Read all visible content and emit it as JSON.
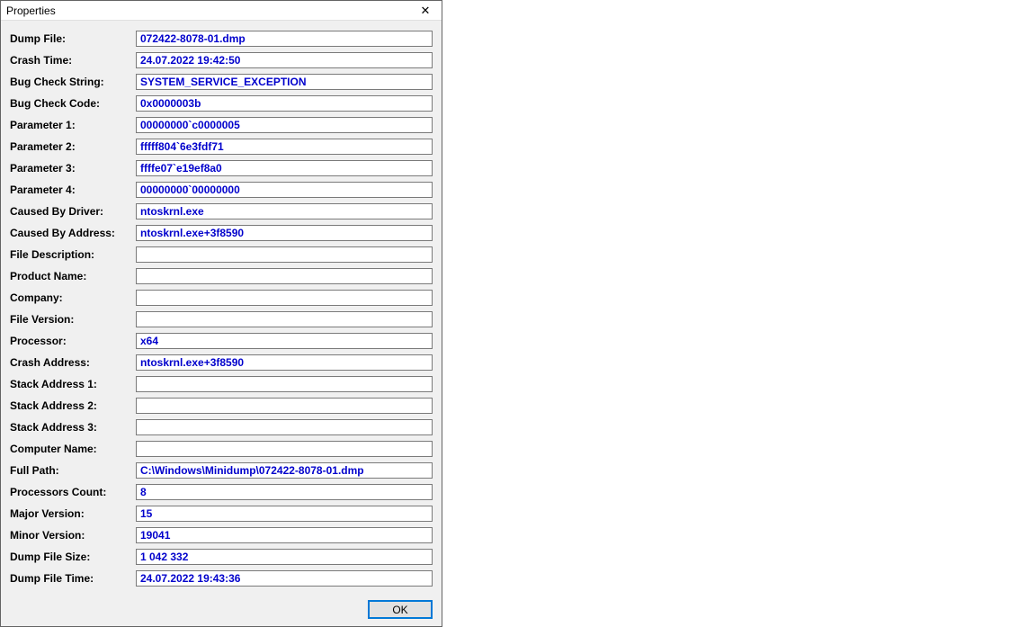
{
  "window": {
    "title": "Properties",
    "close_icon": "✕"
  },
  "fields": [
    {
      "label": "Dump File:",
      "value": "072422-8078-01.dmp"
    },
    {
      "label": "Crash Time:",
      "value": "24.07.2022 19:42:50"
    },
    {
      "label": "Bug Check String:",
      "value": "SYSTEM_SERVICE_EXCEPTION"
    },
    {
      "label": "Bug Check Code:",
      "value": "0x0000003b"
    },
    {
      "label": "Parameter 1:",
      "value": "00000000`c0000005"
    },
    {
      "label": "Parameter 2:",
      "value": "fffff804`6e3fdf71"
    },
    {
      "label": "Parameter 3:",
      "value": "ffffe07`e19ef8a0"
    },
    {
      "label": "Parameter 4:",
      "value": "00000000`00000000"
    },
    {
      "label": "Caused By Driver:",
      "value": "ntoskrnl.exe"
    },
    {
      "label": "Caused By Address:",
      "value": "ntoskrnl.exe+3f8590"
    },
    {
      "label": "File Description:",
      "value": ""
    },
    {
      "label": "Product Name:",
      "value": ""
    },
    {
      "label": "Company:",
      "value": ""
    },
    {
      "label": "File Version:",
      "value": ""
    },
    {
      "label": "Processor:",
      "value": "x64"
    },
    {
      "label": "Crash Address:",
      "value": "ntoskrnl.exe+3f8590"
    },
    {
      "label": "Stack Address 1:",
      "value": ""
    },
    {
      "label": "Stack Address 2:",
      "value": ""
    },
    {
      "label": "Stack Address 3:",
      "value": ""
    },
    {
      "label": "Computer Name:",
      "value": ""
    },
    {
      "label": "Full Path:",
      "value": "C:\\Windows\\Minidump\\072422-8078-01.dmp"
    },
    {
      "label": "Processors Count:",
      "value": "8"
    },
    {
      "label": "Major Version:",
      "value": "15"
    },
    {
      "label": "Minor Version:",
      "value": "19041"
    },
    {
      "label": "Dump File Size:",
      "value": "1 042 332"
    },
    {
      "label": "Dump File Time:",
      "value": "24.07.2022 19:43:36"
    }
  ],
  "footer": {
    "ok_label": "OK"
  }
}
